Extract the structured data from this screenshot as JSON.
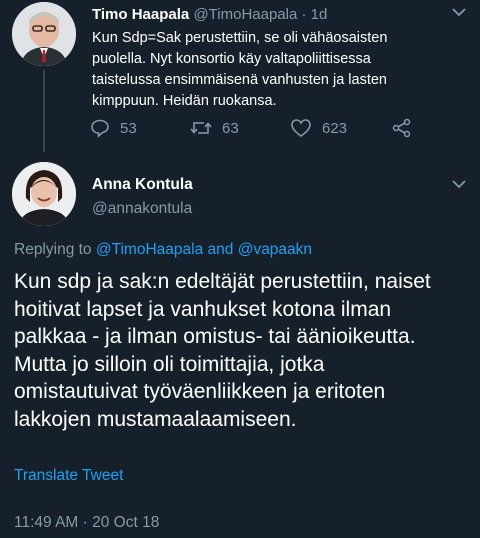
{
  "parent_tweet": {
    "author_name": "Timo Haapala",
    "handle": "@TimoHaapala",
    "separator": "·",
    "time": "1d",
    "text_lines": [
      "Kun Sdp=Sak perustettiin, se oli vähäosaisten",
      "puolella. Nyt konsortio käy valtapoliittisessa",
      "taistelussa ensimmäisenä vanhusten ja lasten",
      "kimppuun. Heidän ruokansa."
    ],
    "actions": {
      "replies": "53",
      "retweets": "63",
      "likes": "623"
    }
  },
  "main_tweet": {
    "author_name": "Anna Kontula",
    "handle": "@annakontula",
    "replying_prefix": "Replying to",
    "replying_to_1": "@TimoHaapala",
    "replying_and": "and",
    "replying_to_2": "@vapaakn",
    "text_lines": [
      "Kun sdp ja sak:n edeltäjät perustettiin, naiset",
      "hoitivat lapset ja vanhukset kotona ilman",
      "palkkaa - ja ilman omistus- tai äänioikeutta.",
      "Mutta jo silloin oli toimittajia, jotka",
      "omistautuivat työväenliikkeen ja eritoten",
      "lakkojen mustamaalaamiseen."
    ],
    "translate_label": "Translate Tweet",
    "timestamp": "11:49 AM · 20 Oct 18"
  }
}
